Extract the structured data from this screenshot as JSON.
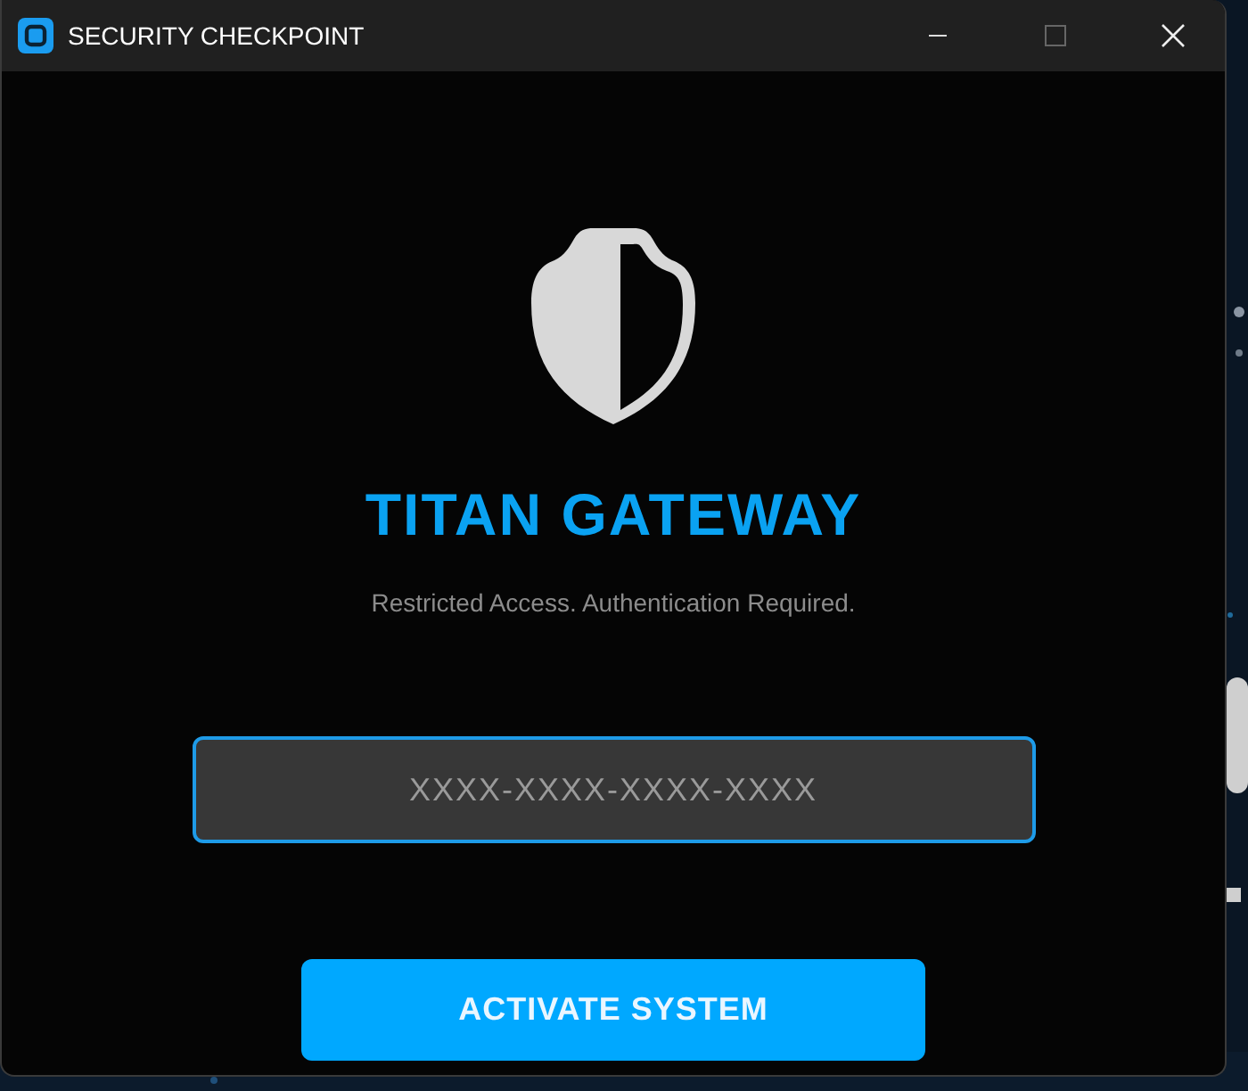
{
  "window": {
    "title": "SECURITY CHECKPOINT"
  },
  "title": "TITAN GATEWAY",
  "subtitle": "Restricted Access. Authentication Required.",
  "key_field": {
    "placeholder": "XXXX-XXXX-XXXX-XXXX"
  },
  "button": {
    "label": "ACTIVATE SYSTEM"
  }
}
